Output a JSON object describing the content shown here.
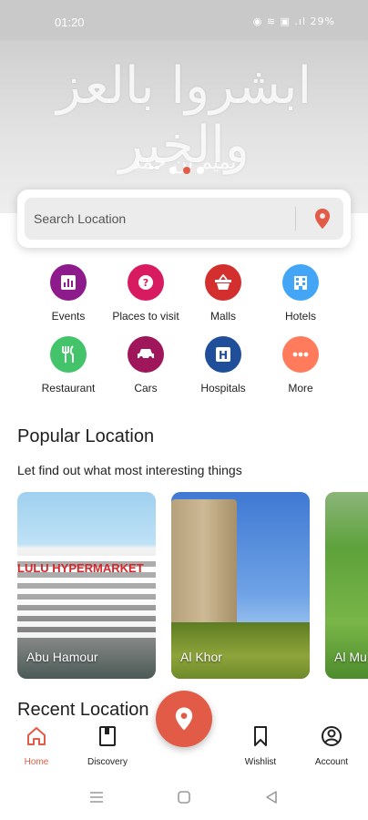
{
  "status_bar": {
    "time": "01:20",
    "system_icons": "◉ ≋ ▣ .ıl 29%"
  },
  "hero": {
    "calligraphy": "ابشروا بالعز والخير",
    "signature": "تميم بن حمد",
    "slide_count": 3,
    "active_slide": 2
  },
  "search": {
    "placeholder": "Search Location",
    "icon": "location-pin-icon"
  },
  "categories": [
    {
      "label": "Events",
      "icon": "chart-icon",
      "color": "#8e1b8c"
    },
    {
      "label": "Places to visit",
      "icon": "question-icon",
      "color": "#d81b60"
    },
    {
      "label": "Malls",
      "icon": "basket-icon",
      "color": "#d32f2f"
    },
    {
      "label": "Hotels",
      "icon": "building-icon",
      "color": "#42a5f5"
    },
    {
      "label": "Restaurant",
      "icon": "cutlery-icon",
      "color": "#43c46b"
    },
    {
      "label": "Cars",
      "icon": "car-icon",
      "color": "#a0165a"
    },
    {
      "label": "Hospitals",
      "icon": "hospital-icon",
      "color": "#1f4e9a"
    },
    {
      "label": "More",
      "icon": "more-dots-icon",
      "color": "#ff7b5c"
    }
  ],
  "popular": {
    "title": "Popular Location",
    "subtitle": "Let find out what most interesting things",
    "cards": [
      {
        "name": "Abu Hamour",
        "brand": "LULU HYPERMARKET"
      },
      {
        "name": "Al Khor"
      },
      {
        "name": "Al Mu"
      }
    ]
  },
  "recent": {
    "title": "Recent Location"
  },
  "bottom_nav": {
    "items": [
      {
        "label": "Home",
        "icon": "home-icon",
        "active": true
      },
      {
        "label": "Discovery",
        "icon": "book-icon",
        "active": false
      },
      {
        "label": "Wishlist",
        "icon": "bookmark-icon",
        "active": false
      },
      {
        "label": "Account",
        "icon": "account-icon",
        "active": false
      }
    ],
    "fab_icon": "location-pin-icon"
  },
  "colors": {
    "accent": "#e25b46",
    "status_bar": "#c9c9c9"
  }
}
